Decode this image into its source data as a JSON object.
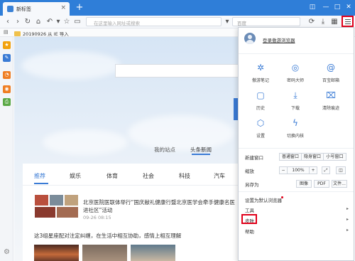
{
  "tab": {
    "title": "新标签",
    "close": "×"
  },
  "titlebar": {
    "new_tab": "+",
    "minimize": "—",
    "maximize": "□",
    "close": "✕",
    "skin": "◫"
  },
  "address": {
    "placeholder": "在这里输入网址或搜索"
  },
  "search": {
    "placeholder": "百度"
  },
  "bookmark": {
    "label": "20190926 从 IE 导入"
  },
  "page": {
    "feed_tabs": [
      "我的站点",
      "头条新闻"
    ],
    "categories": [
      "推荐",
      "娱乐",
      "体育",
      "社会",
      "科技",
      "汽车"
    ],
    "news1": {
      "title": "北京医院医联体举行“国庆献礼健康行暨北京医学会牵手健康名医进社区”活动",
      "date": "09-26 08:15"
    },
    "news2": {
      "title": "这3组星座配对注定纠缠，在生活中相互协助，感情上相互理解"
    }
  },
  "menu": {
    "login": "登录傲游浏览器",
    "grid": [
      {
        "label": "傲游笔记",
        "icon": "note-icon"
      },
      {
        "label": "密码大师",
        "icon": "fingerprint-icon"
      },
      {
        "label": "百宝邮箱",
        "icon": "mail-icon"
      },
      {
        "label": "历史",
        "icon": "history-icon"
      },
      {
        "label": "下载",
        "icon": "download-icon"
      },
      {
        "label": "清除痕迹",
        "icon": "trash-icon"
      },
      {
        "label": "设置",
        "icon": "settings-icon"
      },
      {
        "label": "切换内核",
        "icon": "lightning-icon"
      }
    ],
    "new_window": "新建窗口",
    "new_window_buttons": [
      "普通窗口",
      "隐身窗口",
      "小号窗口"
    ],
    "zoom_label": "缩放",
    "zoom": {
      "minus": "−",
      "value": "100%",
      "plus": "+"
    },
    "save_as": "另存为",
    "save_buttons": [
      "图像",
      "PDF",
      "文件..."
    ],
    "default_browser": "设置为默认浏览器",
    "tools": "工具",
    "skin": "皮肤",
    "help": "帮助"
  },
  "colors": {
    "accent": "#3a7bd5",
    "highlight": "#e0001a",
    "titlebar": "#2f7ed8"
  }
}
